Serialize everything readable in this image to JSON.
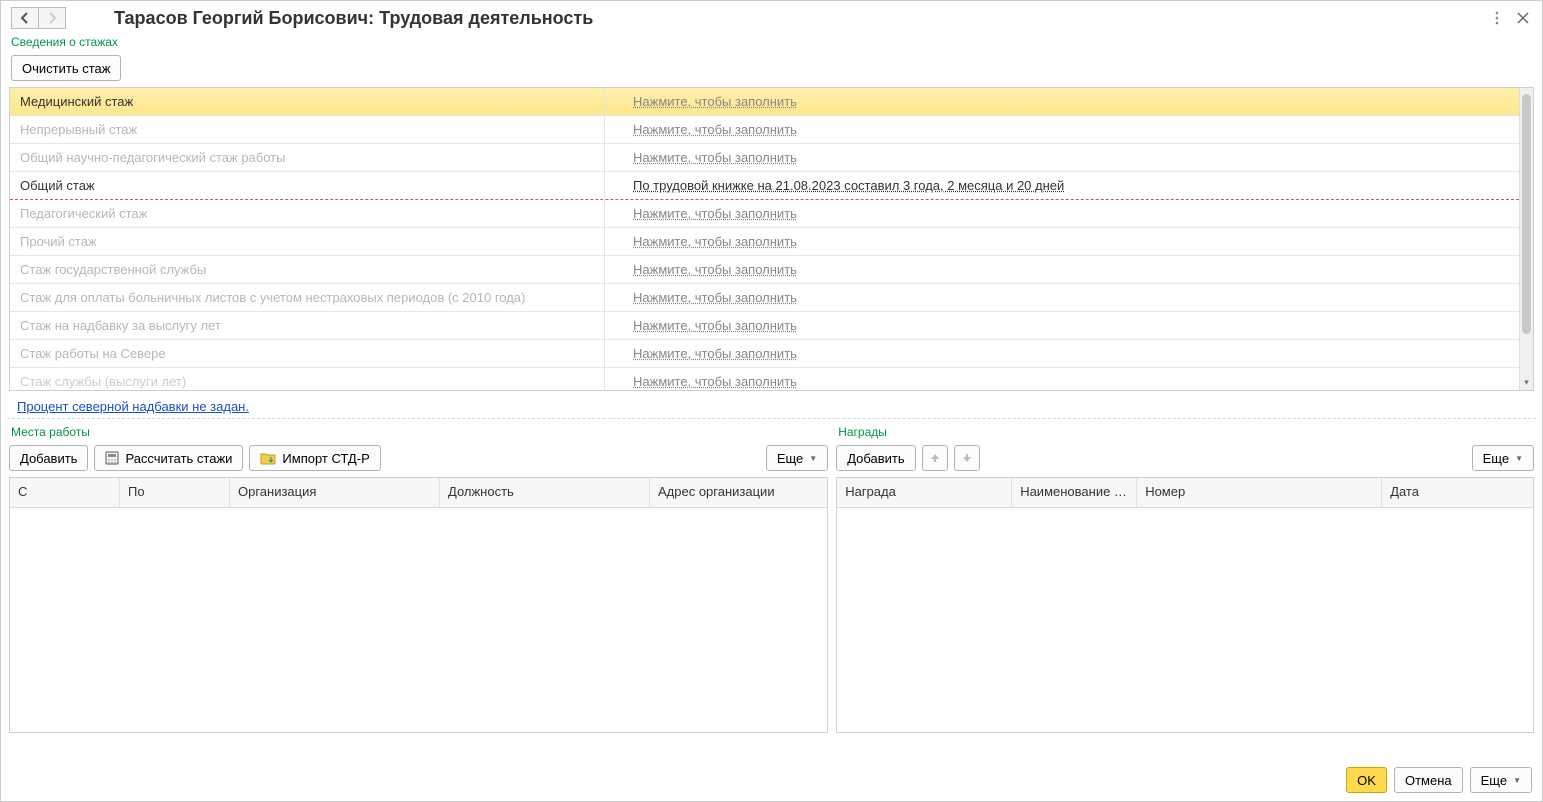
{
  "header": {
    "title": "Тарасов Георгий Борисович: Трудовая деятельность"
  },
  "sections": {
    "seniority": "Сведения о стажах",
    "workplaces": "Места работы",
    "awards": "Награды"
  },
  "buttons": {
    "clear_seniority": "Очистить стаж",
    "add": "Добавить",
    "calc_seniority": "Рассчитать стажи",
    "import_stdr": "Импорт СТД-Р",
    "more": "Еще",
    "ok": "OK",
    "cancel": "Отмена"
  },
  "links": {
    "fill": "Нажмите, чтобы заполнить",
    "north_bonus": "Процент северной надбавки не задан."
  },
  "seniority_rows": [
    {
      "name": "Медицинский стаж",
      "value": null,
      "highlight": true,
      "redline": false,
      "name_active": true
    },
    {
      "name": "Непрерывный стаж",
      "value": null,
      "highlight": false,
      "redline": false,
      "name_active": false
    },
    {
      "name": "Общий научно-педагогический стаж работы",
      "value": null,
      "highlight": false,
      "redline": false,
      "name_active": false
    },
    {
      "name": "Общий стаж",
      "value": "По трудовой книжке на 21.08.2023 составил 3 года, 2 месяца и 20 дней",
      "highlight": false,
      "redline": true,
      "name_active": true
    },
    {
      "name": "Педагогический стаж",
      "value": null,
      "highlight": false,
      "redline": false,
      "name_active": false
    },
    {
      "name": "Прочий стаж",
      "value": null,
      "highlight": false,
      "redline": false,
      "name_active": false
    },
    {
      "name": "Стаж государственной службы",
      "value": null,
      "highlight": false,
      "redline": false,
      "name_active": false
    },
    {
      "name": "Стаж для оплаты больничных листов с учетом нестраховых периодов (с 2010 года)",
      "value": null,
      "highlight": false,
      "redline": false,
      "name_active": false
    },
    {
      "name": "Стаж на надбавку за выслугу лет",
      "value": null,
      "highlight": false,
      "redline": false,
      "name_active": false
    },
    {
      "name": "Стаж работы на Севере",
      "value": null,
      "highlight": false,
      "redline": false,
      "name_active": false
    },
    {
      "name": "Стаж службы (выслуги лет)",
      "value": null,
      "highlight": false,
      "redline": false,
      "name_active": false
    }
  ],
  "workplaces": {
    "columns": {
      "from": "С",
      "to": "По",
      "org": "Организация",
      "position": "Должность",
      "address": "Адрес организации"
    },
    "rows": []
  },
  "awards": {
    "columns": {
      "award": "Награда",
      "doc_name": "Наименование д...",
      "number": "Номер",
      "date": "Дата"
    },
    "rows": []
  }
}
